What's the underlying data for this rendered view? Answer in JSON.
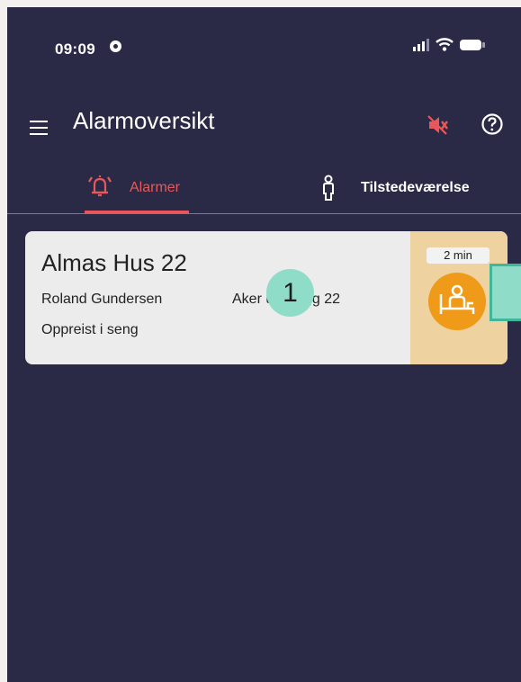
{
  "status_bar": {
    "time": "09:09"
  },
  "app_bar": {
    "title": "Alarmoversikt"
  },
  "tabs": [
    {
      "label": "Alarmer",
      "icon": "alarm-bell-icon",
      "active": true
    },
    {
      "label": "Tilstedeværelse",
      "icon": "person-icon",
      "active": false
    }
  ],
  "alarm_card": {
    "title": "Almas Hus 22",
    "person": "Roland Gundersen",
    "location": "Aker  us, bygg 22",
    "event": "Oppreist i seng",
    "elapsed": "2 min",
    "icon": "bed-exit-icon"
  },
  "annotation": {
    "step": "1"
  },
  "colors": {
    "background": "#2a2a47",
    "accent_red": "#e8585a",
    "card": "#ececec",
    "card_side": "#eed3a0",
    "event_orange": "#f09a1a",
    "marker_teal": "#8fdcc8"
  }
}
